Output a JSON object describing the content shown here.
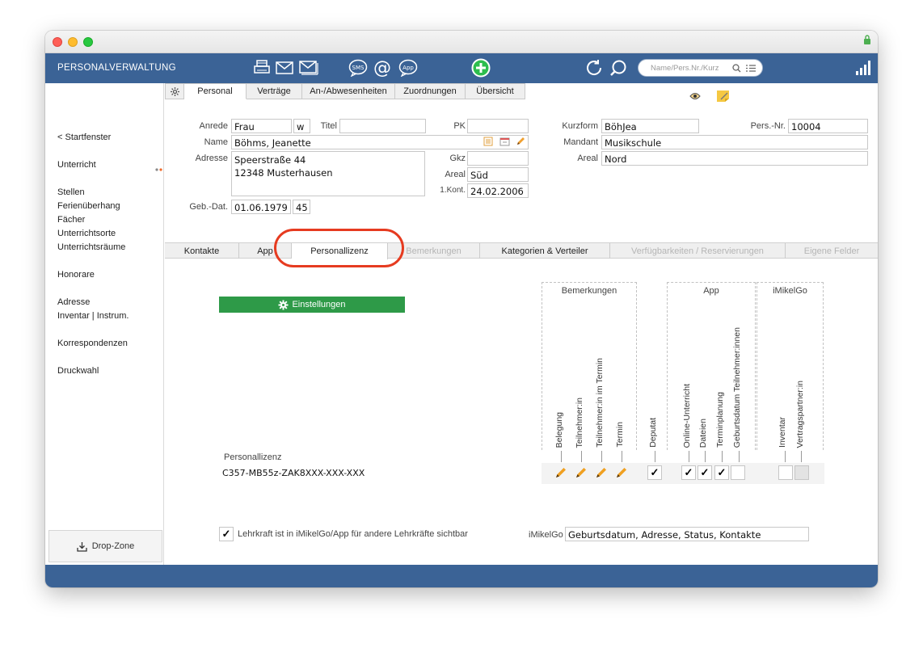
{
  "app": {
    "title": "PERSONALVERWALTUNG"
  },
  "search": {
    "placeholder": "Name/Pers.Nr./Kurz"
  },
  "sidebar": {
    "items": [
      {
        "label": "< Startfenster"
      },
      {
        "label": "Unterricht"
      },
      {
        "label": "Stellen"
      },
      {
        "label": "Ferienüberhang"
      },
      {
        "label": "Fächer"
      },
      {
        "label": "Unterrichtsorte"
      },
      {
        "label": "Unterrichtsräume"
      },
      {
        "label": "Honorare"
      },
      {
        "label": "Adresse"
      },
      {
        "label": "Inventar | Instrum."
      },
      {
        "label": "Korrespondenzen"
      },
      {
        "label": "Druckwahl"
      }
    ],
    "dropzone": "Drop-Zone"
  },
  "tabs_top": [
    {
      "label": "Personal"
    },
    {
      "label": "Verträge"
    },
    {
      "label": "An-/Abwesenheiten"
    },
    {
      "label": "Zuordnungen"
    },
    {
      "label": "Übersicht"
    }
  ],
  "form": {
    "anrede_label": "Anrede",
    "anrede": "Frau",
    "gender": "w",
    "titel_label": "Titel",
    "titel": "",
    "pk_label": "PK",
    "pk": "",
    "name_label": "Name",
    "name": "Böhms, Jeanette",
    "adresse_label": "Adresse",
    "adresse_line1": "Speerstraße 44",
    "adresse_line2": "12348 Musterhausen",
    "gkz_label": "Gkz",
    "gkz": "",
    "areal_label": "Areal",
    "areal": "Süd",
    "kont_label": "1.Kont.",
    "kont": "24.02.2006",
    "gebdat_label": "Geb.-Dat.",
    "gebdat": "01.06.1979",
    "age": "45",
    "kurzform_label": "Kurzform",
    "kurzform": "BöhJea",
    "persnr_label": "Pers.-Nr.",
    "persnr": "10004",
    "mandant_label": "Mandant",
    "mandant": "Musikschule",
    "areal2_label": "Areal",
    "areal2": "Nord"
  },
  "tabs_sub": [
    {
      "label": "Kontakte",
      "disabled": false
    },
    {
      "label": "App",
      "disabled": false
    },
    {
      "label": "Personallizenz",
      "disabled": false
    },
    {
      "label": "Bemerkungen",
      "disabled": true
    },
    {
      "label": "Kategorien & Verteiler",
      "disabled": false
    },
    {
      "label": "Verfügbarkeiten / Reservierungen",
      "disabled": true
    },
    {
      "label": "Eigene Felder",
      "disabled": true
    }
  ],
  "license": {
    "settings_button": "Einstellungen",
    "label": "Personallizenz",
    "code": "C357-MB55z-ZAK8XXX-XXX-XXX",
    "groups": {
      "bemerkungen": "Bemerkungen",
      "app": "App",
      "imikelgo": "iMikelGo"
    },
    "columns": [
      "Belegung",
      "Teilnehmer:in",
      "Teilnehmer:in im Termin",
      "Termin",
      "Deputat",
      "Online-Unterricht",
      "Dateien",
      "Terminplanung",
      "Geburtsdatum Teilnehmer:innen",
      "Inventar",
      "Vertragspartner:in"
    ],
    "checks": {
      "deputat": true,
      "online_unterricht": true,
      "dateien": true,
      "terminplanung": true,
      "geburtsdatum": false,
      "inventar": false,
      "vertragspartner": false
    },
    "visible_label": "Lehrkraft ist in iMikelGo/App für andere Lehrkräfte sichtbar",
    "visible_checked": true,
    "imikelgo_label": "iMikelGo",
    "imikelgo_value": "Geburtsdatum, Adresse, Status, Kontakte"
  },
  "colors": {
    "accent": "#3b6396",
    "green": "#2e9a48",
    "highlight": "#e63b20"
  }
}
